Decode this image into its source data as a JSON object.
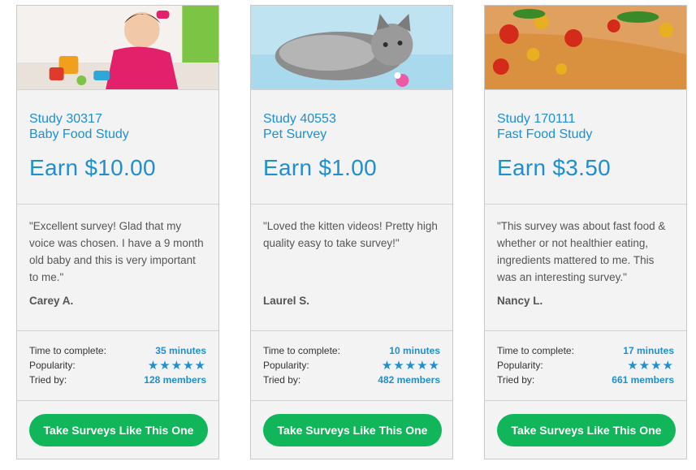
{
  "cards": [
    {
      "study_id": "Study 30317",
      "study_name": "Baby Food Study",
      "earn": "Earn $10.00",
      "quote": "\"Excellent survey! Glad that my voice was chosen. I have a 9 month old baby and this is very important to me.\"",
      "reviewer": "Carey A.",
      "time_label": "Time to complete:",
      "time_value": "35 minutes",
      "popularity_label": "Popularity:",
      "popularity_stars": 5,
      "popularity_display": "★★★★★",
      "tried_label": "Tried by:",
      "tried_value": "128 members",
      "cta": "Take Surveys Like This One",
      "image_icon": "baby-photo"
    },
    {
      "study_id": "Study 40553",
      "study_name": "Pet Survey",
      "earn": "Earn $1.00",
      "quote": "\"Loved the kitten videos! Pretty high quality easy to take survey!\"",
      "reviewer": "Laurel S.",
      "time_label": "Time to complete:",
      "time_value": "10 minutes",
      "popularity_label": "Popularity:",
      "popularity_stars": 5,
      "popularity_display": "★★★★★",
      "tried_label": "Tried by:",
      "tried_value": "482 members",
      "cta": "Take Surveys Like This One",
      "image_icon": "cat-photo"
    },
    {
      "study_id": "Study 170111",
      "study_name": "Fast Food Study",
      "earn": "Earn $3.50",
      "quote": "\"This survey was about fast food & whether or not healthier eating, ingredients mattered to me. This was an interesting survey.\"",
      "reviewer": "Nancy L.",
      "time_label": "Time to complete:",
      "time_value": "17 minutes",
      "popularity_label": "Popularity:",
      "popularity_stars": 4,
      "popularity_display": "★★★★",
      "tried_label": "Tried by:",
      "tried_value": "661 members",
      "cta": "Take Surveys Like This One",
      "image_icon": "pizza-photo"
    }
  ],
  "colors": {
    "accent": "#1f8fcf",
    "cta": "#11b55a",
    "card_bg": "#f3f3f3",
    "border": "#c9c9c9"
  }
}
